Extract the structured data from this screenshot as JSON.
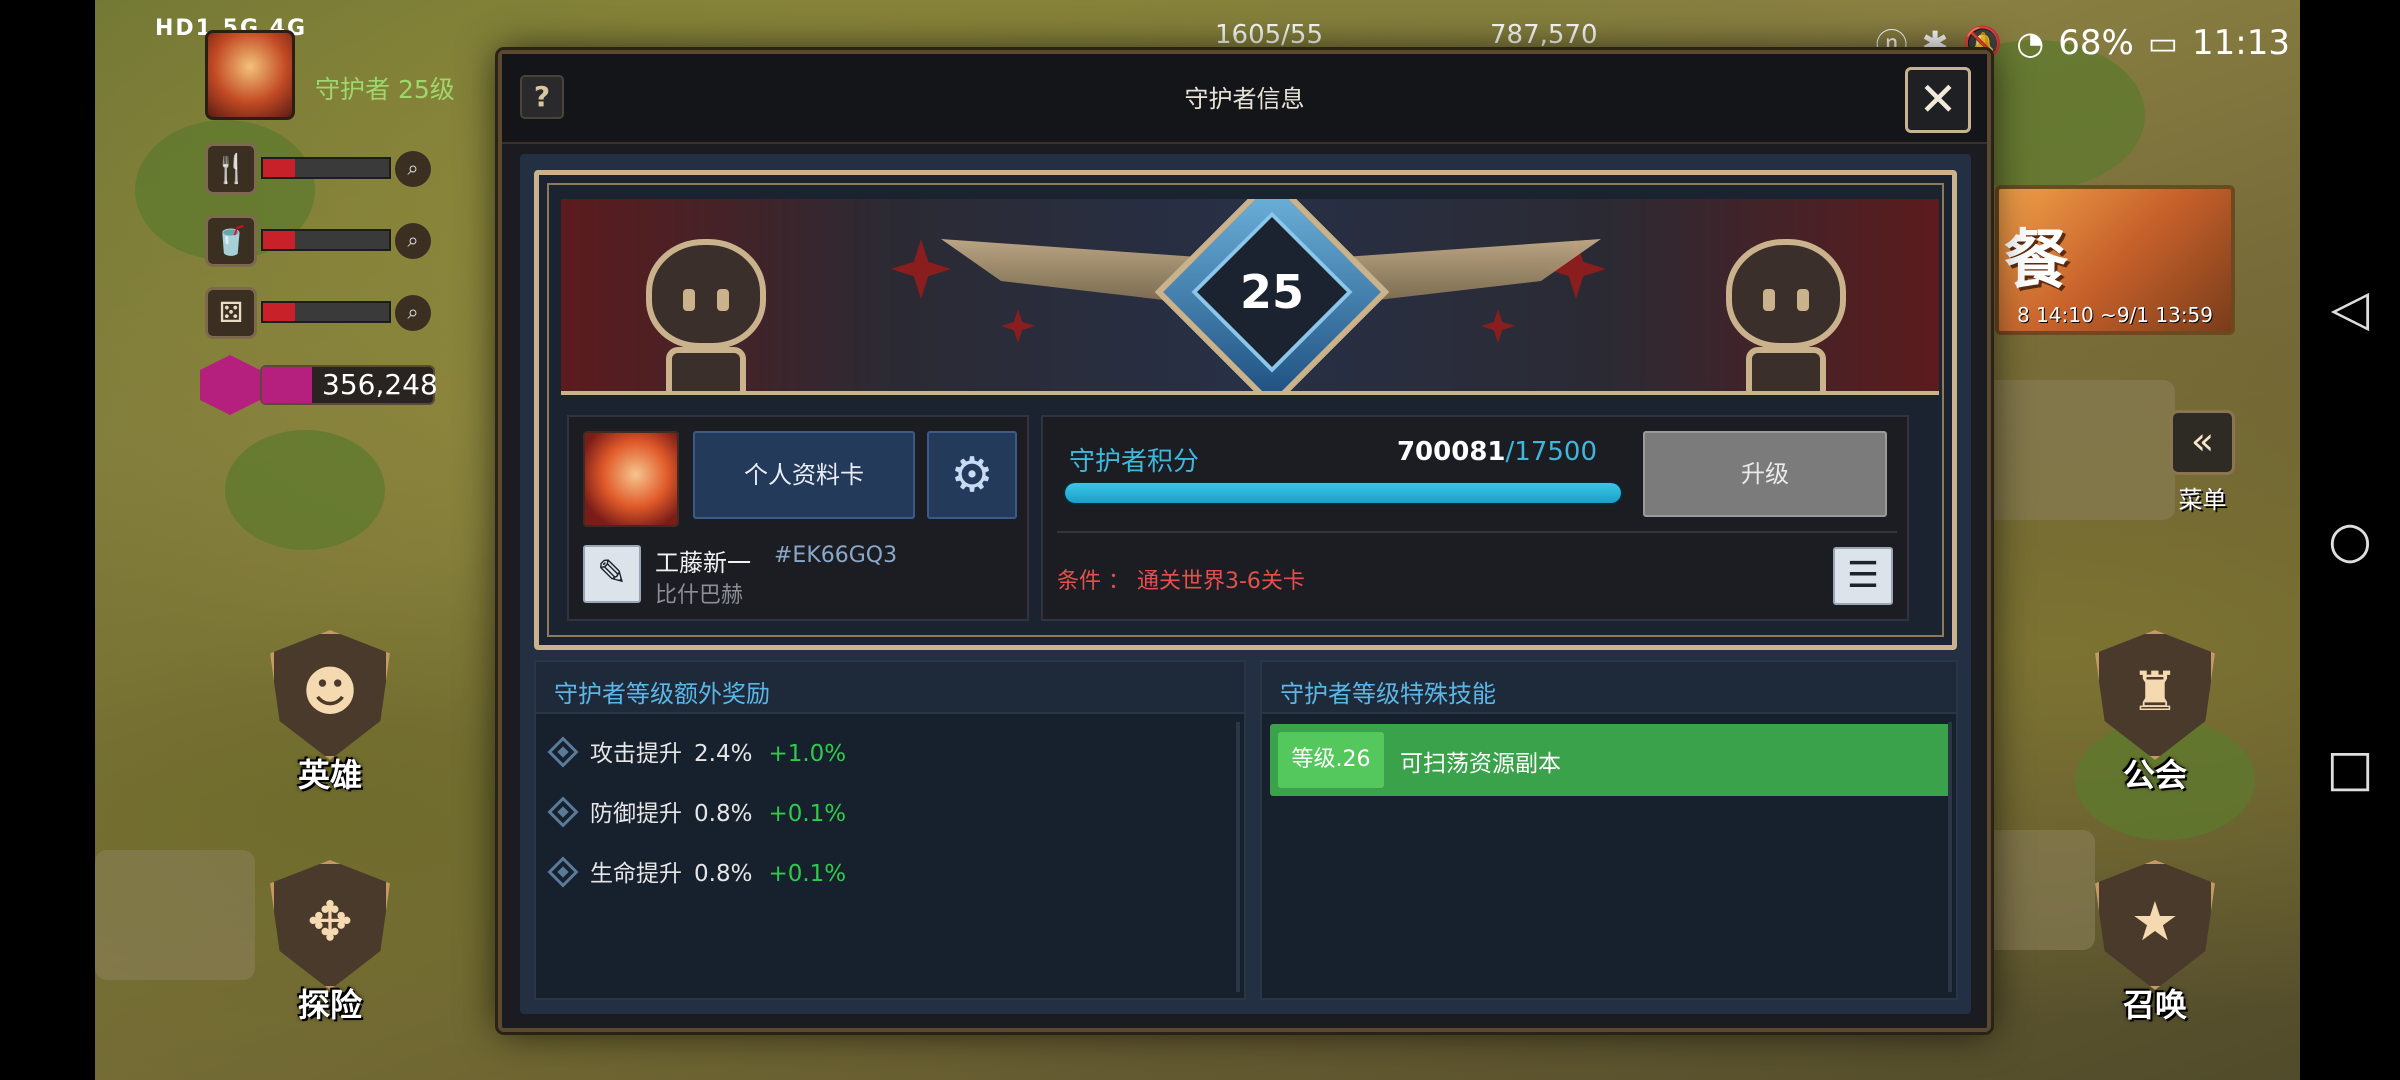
{
  "status_bar": {
    "left": "HD1 5G 4G",
    "battery": "68%",
    "time": "11:13"
  },
  "player": {
    "rank_label": "守护者 25级",
    "gem_count": "356,248"
  },
  "resources": [
    {
      "icon": "fork-knife-icon",
      "fill": 0.25
    },
    {
      "icon": "cup-icon",
      "fill": 0.25
    },
    {
      "icon": "dice-icon",
      "fill": 0.25
    }
  ],
  "top_resources": {
    "stamina": "1605/55",
    "gold": "787,570"
  },
  "nav": {
    "hero": "英雄",
    "explore": "探险",
    "guild": "公会",
    "summon": "召唤",
    "menu": "菜单"
  },
  "event_banner": {
    "title": "餐",
    "dates": "8 14:10 ~9/1 13:59"
  },
  "dialog": {
    "title": "守护者信息",
    "help": "?",
    "close": "✕",
    "level": "25",
    "profile": {
      "card_button": "个人资料卡",
      "name": "工藤新一",
      "tag": "#EK66GQ3",
      "guild": "比什巴赫"
    },
    "score": {
      "label": "守护者积分",
      "current": "700081",
      "max": "/17500",
      "progress": 1.0,
      "upgrade_button": "升级",
      "condition": "条件 ： 通关世界3-6关卡"
    },
    "bonus": {
      "title": "守护者等级额外奖励",
      "rows": [
        {
          "name": "攻击提升",
          "value": "2.4%",
          "gain": "+1.0%"
        },
        {
          "name": "防御提升",
          "value": "0.8%",
          "gain": "+0.1%"
        },
        {
          "name": "生命提升",
          "value": "0.8%",
          "gain": "+0.1%"
        }
      ]
    },
    "skills": {
      "title": "守护者等级特殊技能",
      "rows": [
        {
          "level": "等级.26",
          "name": "可扫荡资源副本"
        }
      ]
    }
  },
  "colors": {
    "accent_blue": "#3fb7dc",
    "condition_red": "#e2514c",
    "gain_green": "#2ecb4a",
    "skill_green": "#39a24a"
  }
}
